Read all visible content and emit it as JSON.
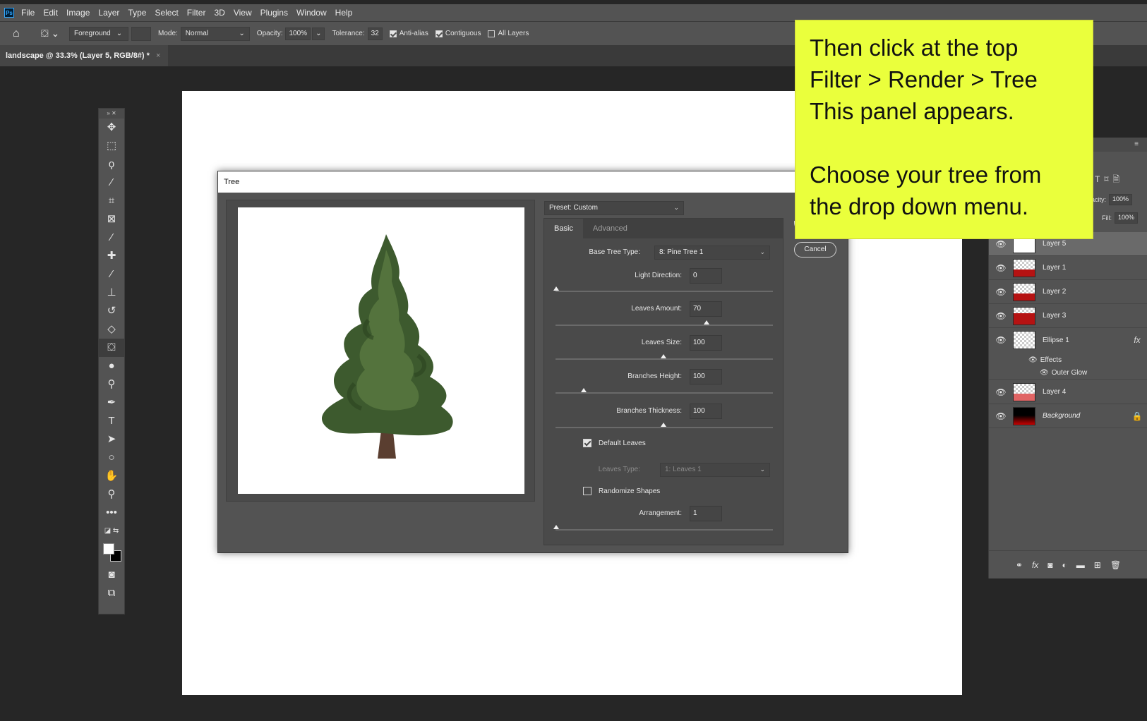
{
  "menubar": {
    "logo": "Ps",
    "items": [
      "File",
      "Edit",
      "Image",
      "Layer",
      "Type",
      "Select",
      "Filter",
      "3D",
      "View",
      "Plugins",
      "Window",
      "Help"
    ]
  },
  "options": {
    "fill_source": "Foreground",
    "mode_label": "Mode:",
    "mode_value": "Normal",
    "opacity_label": "Opacity:",
    "opacity_value": "100%",
    "tolerance_label": "Tolerance:",
    "tolerance_value": "32",
    "antialias_label": "Anti-alias",
    "antialias_checked": true,
    "contiguous_label": "Contiguous",
    "contiguous_checked": true,
    "all_layers_label": "All Layers",
    "all_layers_checked": false
  },
  "document_tab": {
    "title": "landscape @ 33.3% (Layer 5, RGB/8#) *",
    "close": "×"
  },
  "toolbar": {
    "tools": [
      "move-icon",
      "marquee-icon",
      "lasso-icon",
      "magic-wand-icon",
      "crop-icon",
      "frame-icon",
      "eyedropper-icon",
      "healing-icon",
      "brush-icon",
      "stamp-icon",
      "history-brush-icon",
      "eraser-icon",
      "paint-bucket-icon",
      "blur-icon",
      "dodge-icon",
      "pen-icon",
      "type-icon",
      "path-select-icon",
      "ellipse-icon",
      "hand-icon",
      "zoom-icon",
      "more-icon"
    ],
    "active_tool": "paint-bucket-icon"
  },
  "layers_panel": {
    "opacity_label": "pacity:",
    "opacity_value": "100%",
    "fill_label": "Fill:",
    "fill_value": "100%",
    "layers": [
      {
        "name": "Layer 5",
        "selected": true
      },
      {
        "name": "Layer 1",
        "selected": false
      },
      {
        "name": "Layer 2",
        "selected": false
      },
      {
        "name": "Layer 3",
        "selected": false
      },
      {
        "name": "Ellipse 1",
        "selected": false
      },
      {
        "name": "Layer 4",
        "selected": false
      },
      {
        "name": "Background",
        "selected": false
      }
    ],
    "effects_label": "Effects",
    "outer_glow_label": "Outer Glow",
    "fx_label": "fx"
  },
  "tree_dialog": {
    "title": "Tree",
    "preset": "Preset: Custom",
    "tabs": [
      "Basic",
      "Advanced"
    ],
    "active_tab": "Basic",
    "base_tree_type_label": "Base Tree Type:",
    "base_tree_type_value": "8: Pine Tree 1",
    "light_direction_label": "Light Direction:",
    "light_direction_value": "0",
    "leaves_amount_label": "Leaves Amount:",
    "leaves_amount_value": "70",
    "leaves_size_label": "Leaves Size:",
    "leaves_size_value": "100",
    "branches_height_label": "Branches Height:",
    "branches_height_value": "100",
    "branches_thickness_label": "Branches Thickness:",
    "branches_thickness_value": "100",
    "default_leaves_label": "Default Leaves",
    "default_leaves_checked": true,
    "leaves_type_label": "Leaves Type:",
    "leaves_type_value": "1: Leaves 1",
    "randomize_label": "Randomize Shapes",
    "randomize_checked": false,
    "arrangement_label": "Arrangement:",
    "arrangement_value": "1",
    "cancel_label": "Cancel"
  },
  "annotation": {
    "line1": "Then click at the top",
    "line2": "Filter > Render > Tree",
    "line3": "This panel appears.",
    "line4": "Choose your tree from",
    "line5": "the drop down menu."
  }
}
